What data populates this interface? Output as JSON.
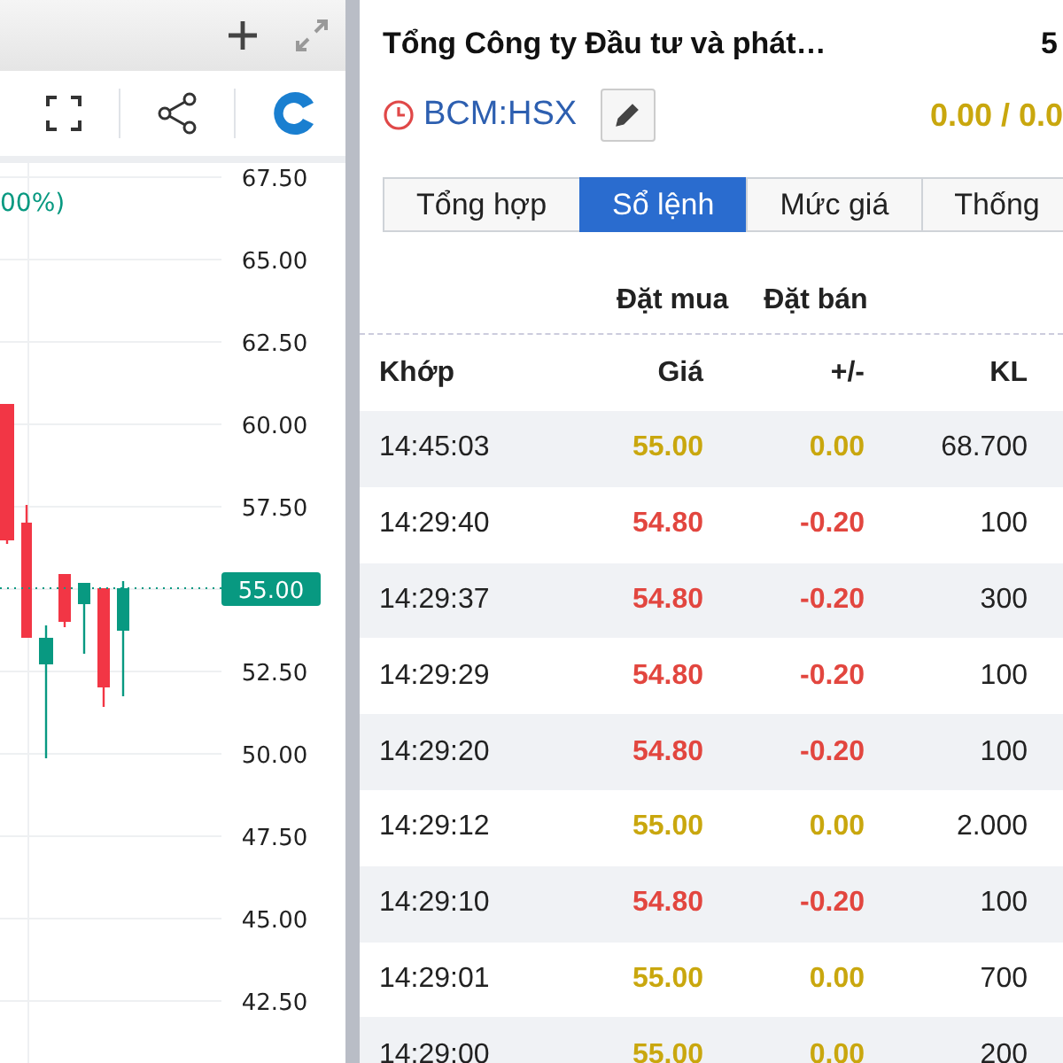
{
  "chart_panel": {
    "change_text": "00%)",
    "y_axis_labels": [
      "67.50",
      "65.00",
      "62.50",
      "60.00",
      "57.50",
      "52.50",
      "50.00",
      "47.50",
      "45.00",
      "42.50"
    ],
    "current_price": "55.00"
  },
  "header": {
    "title": "Tổng Công ty Đầu tư và phát…",
    "price": "5",
    "symbol": "BCM:HSX",
    "change": "0.00 / 0.0"
  },
  "tabs": [
    {
      "label": "Tổng hợp",
      "selected": false
    },
    {
      "label": "Sổ lệnh",
      "selected": true
    },
    {
      "label": "Mức giá",
      "selected": false
    },
    {
      "label": "Thống",
      "selected": false
    }
  ],
  "filters": [
    "Đặt mua",
    "Đặt bán"
  ],
  "table": {
    "columns": [
      "Khớp",
      "Giá",
      "+/-",
      "KL"
    ],
    "rows": [
      {
        "time": "14:45:03",
        "price": "55.00",
        "change": "0.00",
        "volume": "68.700",
        "color": "#c9a70e"
      },
      {
        "time": "14:29:40",
        "price": "54.80",
        "change": "-0.20",
        "volume": "100",
        "color": "#e2463f"
      },
      {
        "time": "14:29:37",
        "price": "54.80",
        "change": "-0.20",
        "volume": "300",
        "color": "#e2463f"
      },
      {
        "time": "14:29:29",
        "price": "54.80",
        "change": "-0.20",
        "volume": "100",
        "color": "#e2463f"
      },
      {
        "time": "14:29:20",
        "price": "54.80",
        "change": "-0.20",
        "volume": "100",
        "color": "#e2463f"
      },
      {
        "time": "14:29:12",
        "price": "55.00",
        "change": "0.00",
        "volume": "2.000",
        "color": "#c9a70e"
      },
      {
        "time": "14:29:10",
        "price": "54.80",
        "change": "-0.20",
        "volume": "100",
        "color": "#e2463f"
      },
      {
        "time": "14:29:01",
        "price": "55.00",
        "change": "0.00",
        "volume": "700",
        "color": "#c9a70e"
      },
      {
        "time": "14:29:00",
        "price": "55.00",
        "change": "0.00",
        "volume": "200",
        "color": "#c9a70e"
      }
    ]
  }
}
